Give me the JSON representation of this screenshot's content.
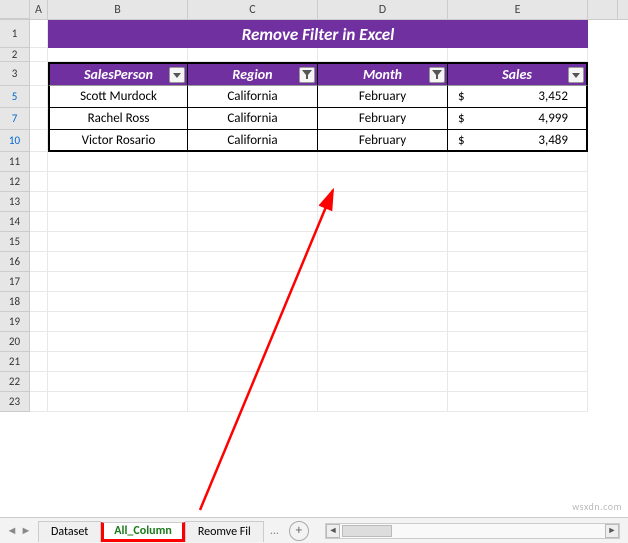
{
  "columns": {
    "A": "A",
    "B": "B",
    "C": "C",
    "D": "D",
    "E": "E"
  },
  "row_numbers": [
    "1",
    "2",
    "3",
    "5",
    "7",
    "10",
    "11",
    "12",
    "13",
    "14",
    "15",
    "16",
    "17",
    "18",
    "19",
    "20",
    "21",
    "22",
    "23"
  ],
  "title": "Remove Filter in Excel",
  "table": {
    "headers": {
      "salesperson": "SalesPerson",
      "region": "Region",
      "month": "Month",
      "sales": "Sales"
    },
    "rows": [
      {
        "num": "5",
        "salesperson": "Scott Murdock",
        "region": "California",
        "month": "February",
        "currency": "$",
        "sales": "3,452"
      },
      {
        "num": "7",
        "salesperson": "Rachel Ross",
        "region": "California",
        "month": "February",
        "currency": "$",
        "sales": "4,999"
      },
      {
        "num": "10",
        "salesperson": "Victor Rosario",
        "region": "California",
        "month": "February",
        "currency": "$",
        "sales": "3,489"
      }
    ],
    "filter_state": {
      "salesperson": "dropdown",
      "region": "filtered",
      "month": "filtered",
      "sales": "dropdown"
    }
  },
  "tabs": {
    "items": [
      {
        "label": "Dataset",
        "active": false
      },
      {
        "label": "All_Column",
        "active": true
      },
      {
        "label": "Reomve Fil",
        "active": false
      }
    ],
    "more": "...",
    "add": "+"
  },
  "watermark": "wsxdn.com",
  "chart_data": {
    "type": "table",
    "title": "Remove Filter in Excel",
    "columns": [
      "SalesPerson",
      "Region",
      "Month",
      "Sales"
    ],
    "rows": [
      [
        "Scott Murdock",
        "California",
        "February",
        3452
      ],
      [
        "Rachel Ross",
        "California",
        "February",
        4999
      ],
      [
        "Victor Rosario",
        "California",
        "February",
        3489
      ]
    ],
    "filtered_columns": [
      "Region",
      "Month"
    ],
    "visible_row_indices": [
      5,
      7,
      10
    ]
  }
}
